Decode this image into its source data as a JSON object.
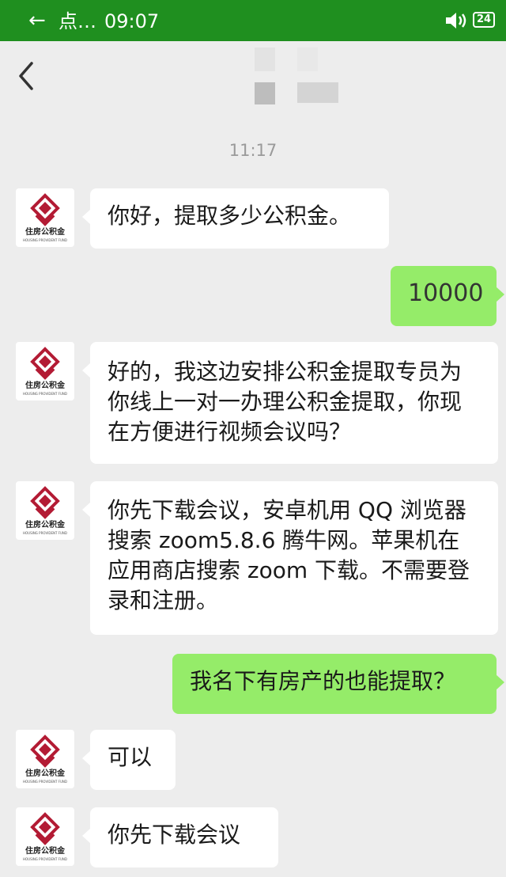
{
  "status_bar": {
    "title": "点…",
    "time": "09:07",
    "battery": "24"
  },
  "timestamp": "11:17",
  "avatar": {
    "label": "住房公积金",
    "sublabel": "HOUSING PROVIDENT FUND",
    "brand_color": "#b31b34"
  },
  "messages": [
    {
      "side": "left",
      "text": "你好，提取多少公积金。"
    },
    {
      "side": "right",
      "text": "10000"
    },
    {
      "side": "left",
      "text": "好的，我这边安排公积金提取专员为你线上一对一办理公积金提取，你现在方便进行视频会议吗？"
    },
    {
      "side": "left",
      "text": "你先下载会议，安卓机用 QQ 浏览器搜索 zoom5.8.6 腾牛网。苹果机在应用商店搜索 zoom 下载。不需要登录和注册。"
    },
    {
      "side": "right",
      "text": "我名下有房产的也能提取？"
    },
    {
      "side": "left",
      "text": "可以"
    },
    {
      "side": "left",
      "text": "你先下载会议"
    }
  ],
  "colors": {
    "status_bar": "#1f8f1f",
    "chat_background": "#ededed",
    "sent_bubble": "#95ec69",
    "received_bubble": "#ffffff"
  }
}
